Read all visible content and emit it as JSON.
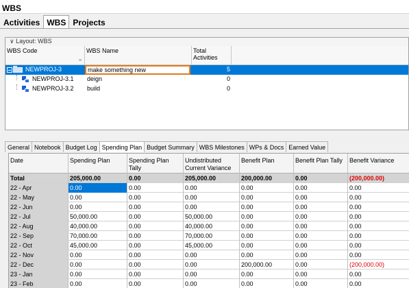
{
  "window": {
    "title": "WBS"
  },
  "main_tabs": [
    {
      "label": "Activities",
      "active": false
    },
    {
      "label": "WBS",
      "active": true
    },
    {
      "label": "Projects",
      "active": false
    }
  ],
  "wbs": {
    "layout_label": "Layout: WBS",
    "columns": {
      "code": "WBS Code",
      "name": "WBS Name",
      "total": "Total Activities"
    },
    "rows": [
      {
        "code": "NEWPROJ-3",
        "name": "make something new",
        "total": "5",
        "selected": true,
        "editing": true
      },
      {
        "code": "NEWPROJ-3.1",
        "name": "deign",
        "total": "0"
      },
      {
        "code": "NEWPROJ-3.2",
        "name": "build",
        "total": "0"
      }
    ]
  },
  "detail_tabs": [
    {
      "label": "General",
      "active": false
    },
    {
      "label": "Notebook",
      "active": false
    },
    {
      "label": "Budget Log",
      "active": false
    },
    {
      "label": "Spending Plan",
      "active": true
    },
    {
      "label": "Budget Summary",
      "active": false
    },
    {
      "label": "WBS Milestones",
      "active": false
    },
    {
      "label": "WPs & Docs",
      "active": false
    },
    {
      "label": "Earned Value",
      "active": false
    }
  ],
  "spending_plan": {
    "columns": {
      "date": "Date",
      "spending_plan": "Spending Plan",
      "spending_plan_tally": "Spending Plan Tally",
      "undistributed": "Undistributed Current Variance",
      "benefit_plan": "Benefit Plan",
      "benefit_plan_tally": "Benefit Plan Tally",
      "benefit_variance": "Benefit Variance"
    },
    "total": {
      "date": "Total",
      "spending_plan": "205,000.00",
      "spending_plan_tally": "0.00",
      "undistributed": "205,000.00",
      "benefit_plan": "200,000.00",
      "benefit_plan_tally": "0.00",
      "benefit_variance": "(200,000.00)"
    },
    "rows": [
      {
        "date": "22 - Apr",
        "spending_plan": "0.00",
        "spending_plan_tally": "0.00",
        "undistributed": "0.00",
        "benefit_plan": "0.00",
        "benefit_plan_tally": "0.00",
        "benefit_variance": "0.00"
      },
      {
        "date": "22 - May",
        "spending_plan": "0.00",
        "spending_plan_tally": "0.00",
        "undistributed": "0.00",
        "benefit_plan": "0.00",
        "benefit_plan_tally": "0.00",
        "benefit_variance": "0.00"
      },
      {
        "date": "22 - Jun",
        "spending_plan": "0.00",
        "spending_plan_tally": "0.00",
        "undistributed": "0.00",
        "benefit_plan": "0.00",
        "benefit_plan_tally": "0.00",
        "benefit_variance": "0.00"
      },
      {
        "date": "22 - Jul",
        "spending_plan": "50,000.00",
        "spending_plan_tally": "0.00",
        "undistributed": "50,000.00",
        "benefit_plan": "0.00",
        "benefit_plan_tally": "0.00",
        "benefit_variance": "0.00"
      },
      {
        "date": "22 - Aug",
        "spending_plan": "40,000.00",
        "spending_plan_tally": "0.00",
        "undistributed": "40,000.00",
        "benefit_plan": "0.00",
        "benefit_plan_tally": "0.00",
        "benefit_variance": "0.00"
      },
      {
        "date": "22 - Sep",
        "spending_plan": "70,000.00",
        "spending_plan_tally": "0.00",
        "undistributed": "70,000.00",
        "benefit_plan": "0.00",
        "benefit_plan_tally": "0.00",
        "benefit_variance": "0.00"
      },
      {
        "date": "22 - Oct",
        "spending_plan": "45,000.00",
        "spending_plan_tally": "0.00",
        "undistributed": "45,000.00",
        "benefit_plan": "0.00",
        "benefit_plan_tally": "0.00",
        "benefit_variance": "0.00"
      },
      {
        "date": "22 - Nov",
        "spending_plan": "0.00",
        "spending_plan_tally": "0.00",
        "undistributed": "0.00",
        "benefit_plan": "0.00",
        "benefit_plan_tally": "0.00",
        "benefit_variance": "0.00"
      },
      {
        "date": "22 - Dec",
        "spending_plan": "0.00",
        "spending_plan_tally": "0.00",
        "undistributed": "0.00",
        "benefit_plan": "200,000.00",
        "benefit_plan_tally": "0.00",
        "benefit_variance": "(200,000.00)"
      },
      {
        "date": "23 - Jan",
        "spending_plan": "0.00",
        "spending_plan_tally": "0.00",
        "undistributed": "0.00",
        "benefit_plan": "0.00",
        "benefit_plan_tally": "0.00",
        "benefit_variance": "0.00"
      },
      {
        "date": "23 - Feb",
        "spending_plan": "0.00",
        "spending_plan_tally": "0.00",
        "undistributed": "0.00",
        "benefit_plan": "0.00",
        "benefit_plan_tally": "0.00",
        "benefit_variance": "0.00"
      }
    ]
  },
  "colors": {
    "selection": "#0078d7",
    "edit_border": "#e07b1f",
    "negative": "#e00000"
  }
}
